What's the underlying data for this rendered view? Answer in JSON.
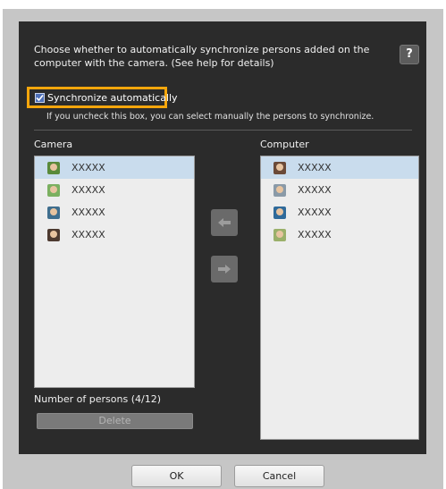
{
  "dialog": {
    "description": "Choose whether to automatically synchronize persons added on the computer with the camera. (See help for details)",
    "help_label": "?",
    "sync": {
      "checked": true,
      "label": "Synchronize automatically",
      "hint": "If you uncheck this box, you can select manually the persons to synchronize."
    },
    "camera": {
      "label": "Camera",
      "items": [
        {
          "name": "XXXXX",
          "selected": true
        },
        {
          "name": "XXXXX",
          "selected": false
        },
        {
          "name": "XXXXX",
          "selected": false
        },
        {
          "name": "XXXXX",
          "selected": false
        }
      ]
    },
    "computer": {
      "label": "Computer",
      "items": [
        {
          "name": "XXXXX",
          "selected": true
        },
        {
          "name": "XXXXX",
          "selected": false
        },
        {
          "name": "XXXXX",
          "selected": false
        },
        {
          "name": "XXXXX",
          "selected": false
        }
      ]
    },
    "transfer": {
      "left_icon": "arrow-left-icon",
      "right_icon": "arrow-right-icon"
    },
    "count_label": "Number of persons (4/12)",
    "delete_label": "Delete",
    "ok_label": "OK",
    "cancel_label": "Cancel",
    "colors": {
      "background": "#2b2b2b",
      "highlight": "#f5a60c",
      "selection": "#c9dced"
    }
  }
}
